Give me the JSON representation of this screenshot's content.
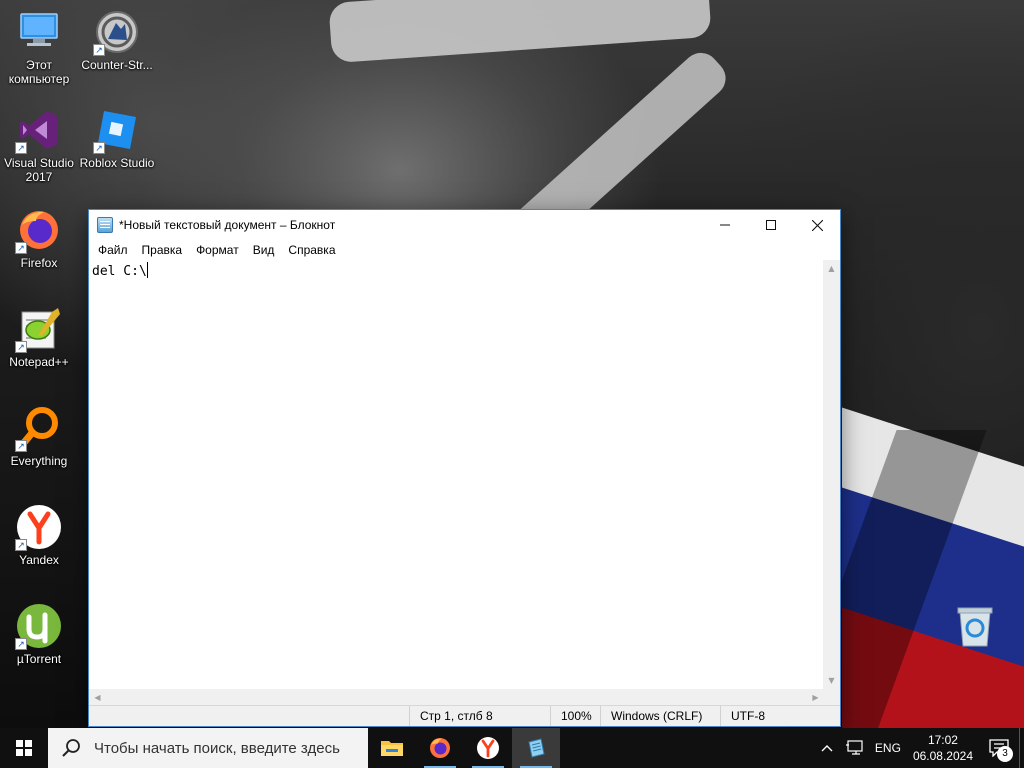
{
  "desktop": {
    "icons": [
      {
        "label": "Этот компьютер",
        "icon": "this-pc-icon"
      },
      {
        "label": "Counter-Str...",
        "icon": "counter-strike-icon"
      },
      {
        "label": "Visual Studio 2017",
        "icon": "visual-studio-icon"
      },
      {
        "label": "Roblox Studio",
        "icon": "roblox-studio-icon"
      },
      {
        "label": "Firefox",
        "icon": "firefox-icon"
      },
      {
        "label": "Notepad++",
        "icon": "notepadpp-icon"
      },
      {
        "label": "Everything",
        "icon": "everything-icon"
      },
      {
        "label": "Yandex",
        "icon": "yandex-icon"
      },
      {
        "label": "µTorrent",
        "icon": "utorrent-icon"
      },
      {
        "label": "",
        "icon": "recycle-bin-icon"
      }
    ]
  },
  "notepad": {
    "title": "*Новый текстовый документ – Блокнот",
    "menu": [
      "Файл",
      "Правка",
      "Формат",
      "Вид",
      "Справка"
    ],
    "content": "del C:\\",
    "status": {
      "position": "Стр 1, стлб 8",
      "zoom": "100%",
      "line_endings": "Windows (CRLF)",
      "encoding": "UTF-8"
    }
  },
  "taskbar": {
    "search_placeholder": "Чтобы начать поиск, введите здесь",
    "apps": [
      {
        "name": "file-explorer",
        "running": false
      },
      {
        "name": "firefox",
        "running": true
      },
      {
        "name": "yandex-browser",
        "running": true
      },
      {
        "name": "notepad",
        "running": true,
        "active": true
      }
    ],
    "language": "ENG",
    "time": "17:02",
    "date": "06.08.2024",
    "notifications": "3"
  },
  "colors": {
    "taskbar_bg": "#101010",
    "window_border": "#4a86c5",
    "running_indicator": "#76b9ed"
  }
}
